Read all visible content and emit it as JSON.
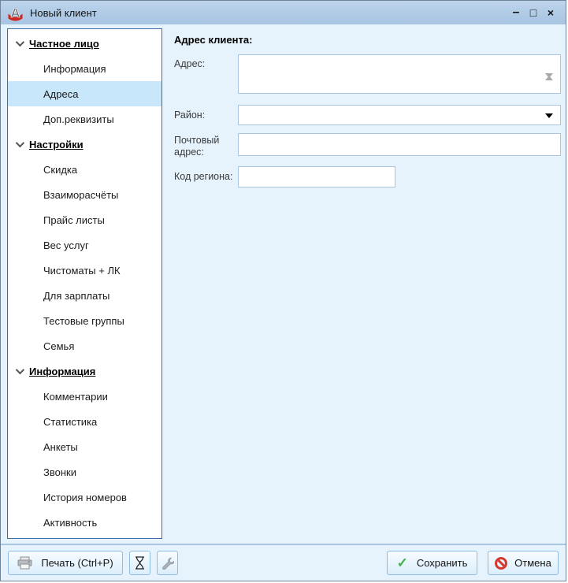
{
  "window": {
    "title": "Новый клиент",
    "controls": {
      "minimize": "–",
      "maximize": "□",
      "close": "×"
    }
  },
  "sidebar": {
    "groups": [
      {
        "label": "Частное лицо",
        "items": [
          {
            "label": "Информация",
            "selected": false
          },
          {
            "label": "Адреса",
            "selected": true
          },
          {
            "label": "Доп.реквизиты",
            "selected": false
          }
        ]
      },
      {
        "label": "Настройки",
        "items": [
          {
            "label": "Скидка",
            "selected": false
          },
          {
            "label": "Взаиморасчёты",
            "selected": false
          },
          {
            "label": "Прайс листы",
            "selected": false
          },
          {
            "label": "Вес услуг",
            "selected": false
          },
          {
            "label": "Чистоматы + ЛК",
            "selected": false
          },
          {
            "label": "Для зарплаты",
            "selected": false
          },
          {
            "label": "Тестовые группы",
            "selected": false
          },
          {
            "label": "Семья",
            "selected": false
          }
        ]
      },
      {
        "label": "Информация",
        "items": [
          {
            "label": "Комментарии",
            "selected": false
          },
          {
            "label": "Статистика",
            "selected": false
          },
          {
            "label": "Анкеты",
            "selected": false
          },
          {
            "label": "Звонки",
            "selected": false
          },
          {
            "label": "История номеров",
            "selected": false
          },
          {
            "label": "Активность",
            "selected": false
          }
        ]
      }
    ]
  },
  "form": {
    "title": "Адрес клиента:",
    "address": {
      "label": "Адрес:",
      "value": ""
    },
    "district": {
      "label": "Район:",
      "value": ""
    },
    "postal": {
      "label": "Почтовый адрес:",
      "value": ""
    },
    "region_code": {
      "label": "Код региона:",
      "value": ""
    }
  },
  "toolbar": {
    "print_label": "Печать (Ctrl+P)",
    "save_label": "Сохранить",
    "cancel_label": "Отмена"
  },
  "colors": {
    "titlebar": "#aec9e5",
    "content_bg": "#e6f3fc",
    "sidebar_border": "#3e6ca5",
    "selected_item": "#c9e7fa",
    "input_border": "#aac7e1",
    "button_border": "#8fbce2",
    "save_check": "#43b049",
    "cancel_sign": "#d63a2f"
  }
}
